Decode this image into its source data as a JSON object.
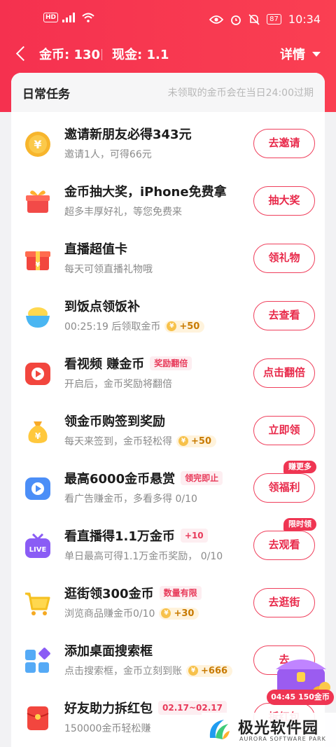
{
  "status_bar": {
    "hd": "HD",
    "battery": "87",
    "time": "10:34"
  },
  "header": {
    "coins": "金币: 130",
    "cash": "现金: 1.1",
    "detail": "详情"
  },
  "section": {
    "title": "日常任务",
    "note": "未领取的金币会在当日24:00过期"
  },
  "tasks": [
    {
      "title": "邀请新朋友必得343元",
      "sub": "邀请1人，可得66元",
      "button": "去邀请",
      "icon": "gold-coin-icon"
    },
    {
      "title": "金币抽大奖，iPhone免费拿",
      "sub": "超多丰厚好礼，等您免费来",
      "button": "抽大奖",
      "icon": "gift-box-icon"
    },
    {
      "title": "直播超值卡",
      "sub": "每天可领直播礼物哦",
      "button": "领礼物",
      "icon": "red-gift-card-icon"
    },
    {
      "title": "到饭点领饭补",
      "sub": "00:25:19 后领取金币",
      "chip": "+50",
      "button": "去查看",
      "icon": "rice-bowl-icon"
    },
    {
      "title": "看视频 赚金币",
      "tag": "奖励翻倍",
      "sub": "开启后，金币奖励将翻倍",
      "button": "点击翻倍",
      "icon": "video-play-icon"
    },
    {
      "title": "领金币购签到奖励",
      "sub": "每天来签到，金币轻松得",
      "chip": "+50",
      "button": "立即领",
      "icon": "money-bag-icon"
    },
    {
      "title": "最高6000金币悬赏",
      "tag": "领完即止",
      "sub": "看广告赚金币，多看多得 0/10",
      "button": "领福利",
      "badge": "赚更多",
      "icon": "ad-play-icon"
    },
    {
      "title": "看直播得1.1万金币",
      "tag": "+10",
      "sub": "单日最高可得1.1万金币奖励，  0/10",
      "button": "去观看",
      "badge": "限时领",
      "icon": "live-tv-icon"
    },
    {
      "title": "逛街领300金币",
      "tag": "数量有限",
      "sub": "浏览商品赚金币0/10",
      "chip": "+30",
      "button": "去逛街",
      "icon": "shopping-cart-icon"
    },
    {
      "title": "添加桌面搜索框",
      "sub": "点击搜索框，金币立刻到账",
      "chip": "+666",
      "button": "去",
      "icon": "app-grid-icon"
    },
    {
      "title": "好友助力拆红包",
      "tag": "02.17~02.17",
      "sub": "150000金币轻松赚",
      "button": "拆红包",
      "icon": "red-envelope-icon"
    }
  ],
  "coin_glyph": "¥",
  "float": {
    "timer": "04:45  150金币"
  },
  "watermark": {
    "cn": "极光软件园",
    "en": "AURORA SOFTWARE PARK"
  },
  "colors": {
    "brand": "#f5314f",
    "button": "#ef3f5c",
    "gold": "#f7c14a"
  }
}
